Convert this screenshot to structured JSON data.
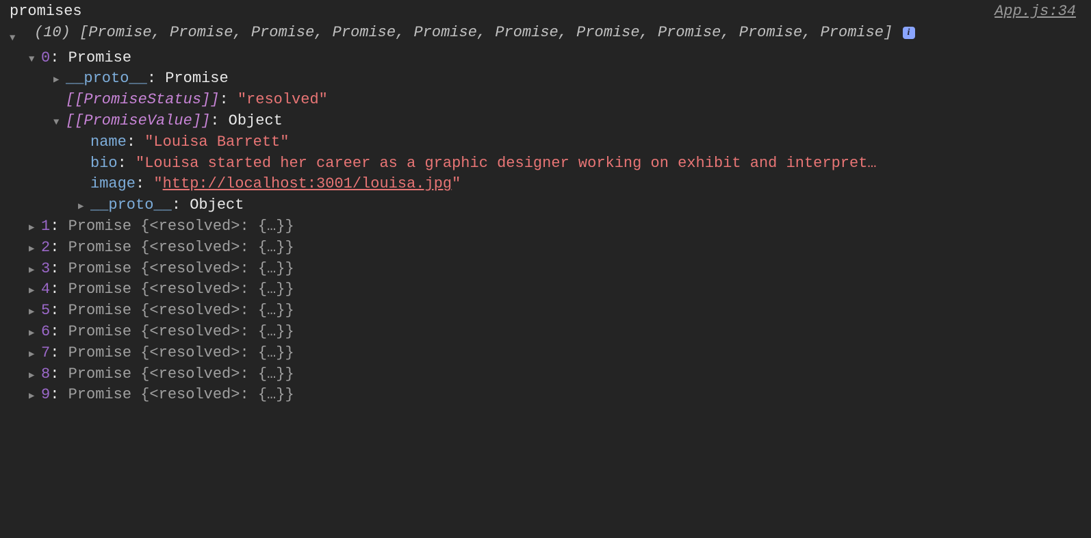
{
  "header": {
    "label": "promises",
    "source": "App.js:34"
  },
  "summary": {
    "count": "(10)",
    "text": "[Promise, Promise, Promise, Promise, Promise, Promise, Promise, Promise, Promise, Promise]"
  },
  "first_item": {
    "index": "0",
    "type": "Promise",
    "proto_outer_key": "__proto__",
    "proto_outer_value": "Promise",
    "status_key": "[[PromiseStatus]]",
    "status_value": "\"resolved\"",
    "value_key": "[[PromiseValue]]",
    "value_type": "Object",
    "obj": {
      "name_key": "name",
      "name_val": "\"Louisa Barrett\"",
      "bio_key": "bio",
      "bio_val": "\"Louisa started her career as a graphic designer working on exhibit and interpret…",
      "image_key": "image",
      "image_val_q1": "\"",
      "image_val_url": "http://localhost:3001/louisa.jpg",
      "image_val_q2": "\"",
      "proto_key": "__proto__",
      "proto_val": "Object"
    }
  },
  "rest": [
    {
      "index": "1",
      "text": "Promise {<resolved>: {…}}"
    },
    {
      "index": "2",
      "text": "Promise {<resolved>: {…}}"
    },
    {
      "index": "3",
      "text": "Promise {<resolved>: {…}}"
    },
    {
      "index": "4",
      "text": "Promise {<resolved>: {…}}"
    },
    {
      "index": "5",
      "text": "Promise {<resolved>: {…}}"
    },
    {
      "index": "6",
      "text": "Promise {<resolved>: {…}}"
    },
    {
      "index": "7",
      "text": "Promise {<resolved>: {…}}"
    },
    {
      "index": "8",
      "text": "Promise {<resolved>: {…}}"
    },
    {
      "index": "9",
      "text": "Promise {<resolved>: {…}}"
    }
  ]
}
